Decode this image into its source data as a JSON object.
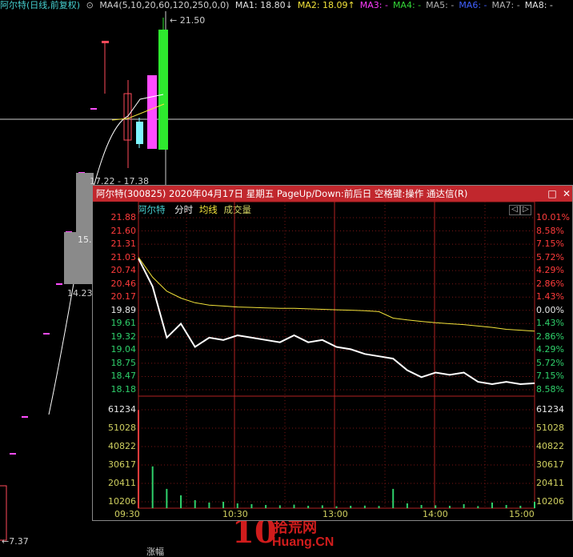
{
  "header": {
    "stock_title": "阿尔特(日线,前复权)",
    "ma_params": "MA4(5,10,20,60,120,250,0,0)",
    "ma_items": [
      {
        "label": "MA1: 18.80↓",
        "color": "#e0e0e0"
      },
      {
        "label": "MA2: 18.09↑",
        "color": "#f2e23a"
      },
      {
        "label": "MA3: -",
        "color": "#ff3cff"
      },
      {
        "label": "MA4: -",
        "color": "#34d838"
      },
      {
        "label": "MA5: -",
        "color": "#b0b0b0"
      },
      {
        "label": "MA6: -",
        "color": "#4060ff"
      },
      {
        "label": "MA7: -",
        "color": "#b0b0b0"
      },
      {
        "label": "MA8: -",
        "color": "#e0e0e0"
      }
    ]
  },
  "background": {
    "high_label": "21.50",
    "range_label": "17.22 - 17.38",
    "price_label_a": "15.",
    "price_label_b": "14.23",
    "low_label": "7.37",
    "bottom_text": "涨幅"
  },
  "popup": {
    "title": "阿尔特(300825)  2020年04月17日  星期五  PageUp/Down:前后日  空格键:操作  通达信(R)",
    "window_buttons": {
      "restore": "□",
      "close": "✕"
    },
    "info_buttons": {
      "left": "◁",
      "right": "▷"
    },
    "subtitle": {
      "name": "阿尔特",
      "fenshi": "分时",
      "avg": "均线",
      "volume": "成交量"
    },
    "price_axis_left": [
      "21.88",
      "21.60",
      "21.31",
      "21.03",
      "20.74",
      "20.46",
      "20.17",
      "19.89",
      "19.61",
      "19.32",
      "19.04",
      "18.75",
      "18.47",
      "18.18"
    ],
    "pct_axis_right": [
      "10.01%",
      "8.58%",
      "7.15%",
      "5.72%",
      "4.29%",
      "2.86%",
      "1.43%",
      "0.00%",
      "1.43%",
      "2.86%",
      "4.29%",
      "5.72%",
      "7.15%",
      "8.58%"
    ],
    "volume_axis_left": [
      "61234",
      "51028",
      "40822",
      "30617",
      "20411",
      "10206"
    ],
    "volume_axis_right": [
      "61234",
      "51028",
      "40822",
      "30617",
      "20411",
      "10206"
    ],
    "time_axis": [
      "09:30",
      "10:30",
      "13:00",
      "14:00",
      "15:00"
    ]
  },
  "chart_data": {
    "type": "line",
    "title": "",
    "prev_close": 19.89,
    "ylim": [
      18.18,
      21.88
    ],
    "x": [
      "09:30",
      "09:35",
      "09:40",
      "09:45",
      "09:50",
      "09:55",
      "10:00",
      "10:10",
      "10:20",
      "10:30",
      "10:40",
      "10:50",
      "11:00",
      "11:10",
      "11:20",
      "11:30",
      "13:00",
      "13:10",
      "13:20",
      "13:30",
      "13:40",
      "13:50",
      "14:00",
      "14:10",
      "14:20",
      "14:30",
      "14:40",
      "14:50",
      "15:00"
    ],
    "series": [
      {
        "name": "",
        "color": "#ffffff",
        "values": [
          21.0,
          20.4,
          19.3,
          19.6,
          19.1,
          19.3,
          19.25,
          19.35,
          19.3,
          19.25,
          19.2,
          19.35,
          19.2,
          19.25,
          19.1,
          19.05,
          18.95,
          18.9,
          18.85,
          18.6,
          18.45,
          18.55,
          18.5,
          18.55,
          18.35,
          18.3,
          18.35,
          18.3,
          18.32
        ]
      },
      {
        "name": "",
        "color": "#f2e23a",
        "values": [
          21.03,
          20.6,
          20.3,
          20.15,
          20.05,
          20.0,
          19.98,
          19.96,
          19.95,
          19.94,
          19.93,
          19.93,
          19.92,
          19.91,
          19.9,
          19.89,
          19.88,
          19.86,
          19.72,
          19.68,
          19.65,
          19.62,
          19.6,
          19.58,
          19.55,
          19.52,
          19.48,
          19.46,
          19.44
        ]
      }
    ],
    "volume": {
      "ylim": [
        0,
        61234
      ],
      "values": [
        61000,
        26000,
        12000,
        8000,
        5000,
        3500,
        4000,
        3000,
        2500,
        2000,
        1800,
        2200,
        1500,
        1800,
        1200,
        1500,
        1600,
        1400,
        12000,
        3000,
        2000,
        1800,
        1500,
        2500,
        1300,
        3500,
        2000,
        1500,
        4000
      ]
    }
  }
}
